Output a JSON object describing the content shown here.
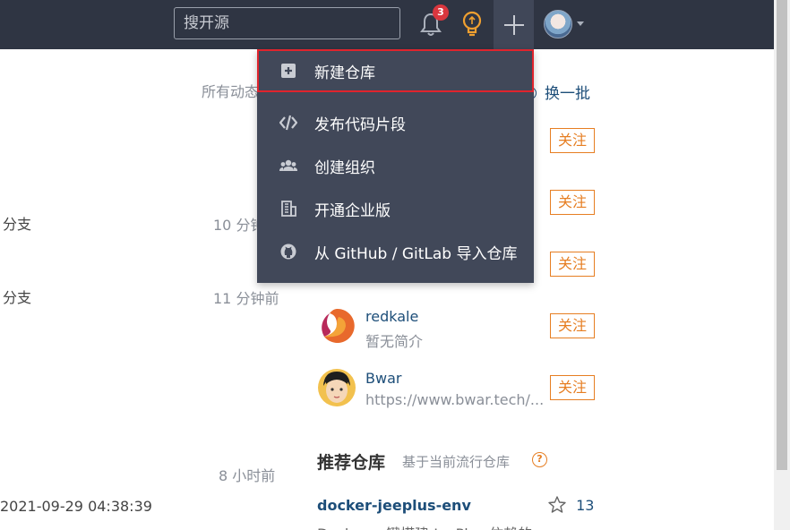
{
  "header": {
    "search_placeholder": "搜开源",
    "notification_count": "3"
  },
  "create_menu": {
    "items": [
      {
        "label": "新建仓库",
        "icon": "plus-square-icon",
        "highlighted": true
      },
      {
        "label": "发布代码片段",
        "icon": "code-icon"
      },
      {
        "label": "创建组织",
        "icon": "users-icon"
      },
      {
        "label": "开通企业版",
        "icon": "building-icon"
      },
      {
        "label": "从 GitHub / GitLab 导入仓库",
        "icon": "github-icon"
      }
    ]
  },
  "feed": {
    "filter_label": "所有动态",
    "rows": [
      {
        "text": "分支",
        "time": "10 分钟前"
      },
      {
        "text": "分支",
        "time": "11 分钟前"
      },
      {
        "text": "",
        "time": "8 小时前"
      },
      {
        "text": "2021-09-29 04:38:39",
        "time": ""
      }
    ]
  },
  "recommend_users": {
    "refresh_label": "换一批",
    "follow_label": "关注",
    "users": [
      {
        "name": "redkale",
        "desc": "暂无简介"
      },
      {
        "name": "Bwar",
        "desc": "https://www.bwar.tech/..."
      }
    ]
  },
  "recommend_repos": {
    "title": "推荐仓库",
    "subtitle": "基于当前流行仓库",
    "help": "?",
    "repo": {
      "name": "docker-jeeplus-env",
      "stars": "13",
      "desc": "Docker 一键搭建 JeePlus 依赖的..."
    }
  },
  "colors": {
    "header_bg": "#2f3543",
    "dropdown_bg": "#414859",
    "accent_orange": "#e67e22",
    "link_blue": "#1d4e79",
    "highlight_red": "#e0242d"
  }
}
